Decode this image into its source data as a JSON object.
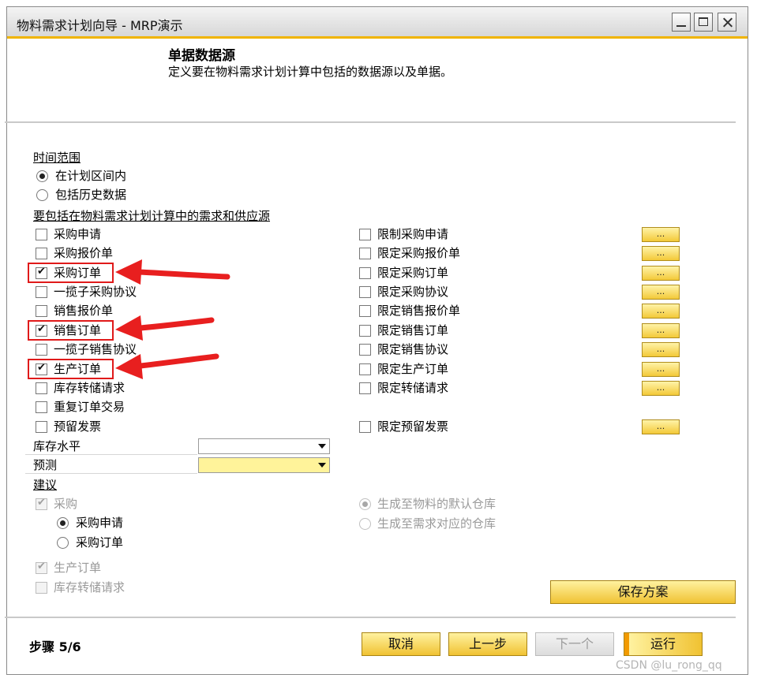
{
  "window": {
    "title": "物料需求计划向导 - MRP演示"
  },
  "header": {
    "title": "单据数据源",
    "description": "定义要在物料需求计划计算中包括的数据源以及单据。"
  },
  "time_range": {
    "label": "时间范围",
    "options": [
      {
        "label": "在计划区间内",
        "selected": true
      },
      {
        "label": "包括历史数据",
        "selected": false
      }
    ]
  },
  "sources": {
    "label": "要包括在物料需求计划计算中的需求和供应源",
    "left": [
      {
        "label": "采购申请",
        "checked": false
      },
      {
        "label": "采购报价单",
        "checked": false
      },
      {
        "label": "采购订单",
        "checked": true
      },
      {
        "label": "一揽子采购协议",
        "checked": false
      },
      {
        "label": "销售报价单",
        "checked": false
      },
      {
        "label": "销售订单",
        "checked": true
      },
      {
        "label": "一揽子销售协议",
        "checked": false
      },
      {
        "label": "生产订单",
        "checked": true
      },
      {
        "label": "库存转储请求",
        "checked": false
      },
      {
        "label": "重复订单交易",
        "checked": false
      },
      {
        "label": "预留发票",
        "checked": false
      }
    ],
    "right": [
      {
        "label": "限制采购申请",
        "checked": false
      },
      {
        "label": "限定采购报价单",
        "checked": false
      },
      {
        "label": "限定采购订单",
        "checked": false
      },
      {
        "label": "限定采购协议",
        "checked": false
      },
      {
        "label": "限定销售报价单",
        "checked": false
      },
      {
        "label": "限定销售订单",
        "checked": false
      },
      {
        "label": "限定销售协议",
        "checked": false
      },
      {
        "label": "限定生产订单",
        "checked": false
      },
      {
        "label": "限定转储请求",
        "checked": false
      },
      {
        "label": "限定预留发票",
        "checked": false
      }
    ],
    "ellipsis": "..."
  },
  "stock_level": {
    "label": "库存水平",
    "value": ""
  },
  "forecast": {
    "label": "预测",
    "value": ""
  },
  "recommendation": {
    "label": "建议",
    "purchase": {
      "label": "采购",
      "checked": true
    },
    "purchase_options": [
      {
        "label": "采购申请",
        "selected": true
      },
      {
        "label": "采购订单",
        "selected": false
      }
    ],
    "production_order": {
      "label": "生产订单",
      "checked": true
    },
    "inventory_transfer": {
      "label": "库存转储请求",
      "checked": false
    },
    "warehouse_options": [
      {
        "label": "生成至物料的默认仓库",
        "selected": true
      },
      {
        "label": "生成至需求对应的仓库",
        "selected": false
      }
    ]
  },
  "buttons": {
    "save_scheme": "保存方案",
    "cancel": "取消",
    "prev": "上一步",
    "next": "下一个",
    "run": "运行"
  },
  "footer": {
    "step": "步骤 5/6"
  },
  "watermark": "CSDN @lu_rong_qq",
  "colors": {
    "accent_yellow": "#f0c232",
    "title_bar_line": "#f0b400",
    "highlight_red": "#e01a1a",
    "arrow_red": "#e81f1f"
  }
}
